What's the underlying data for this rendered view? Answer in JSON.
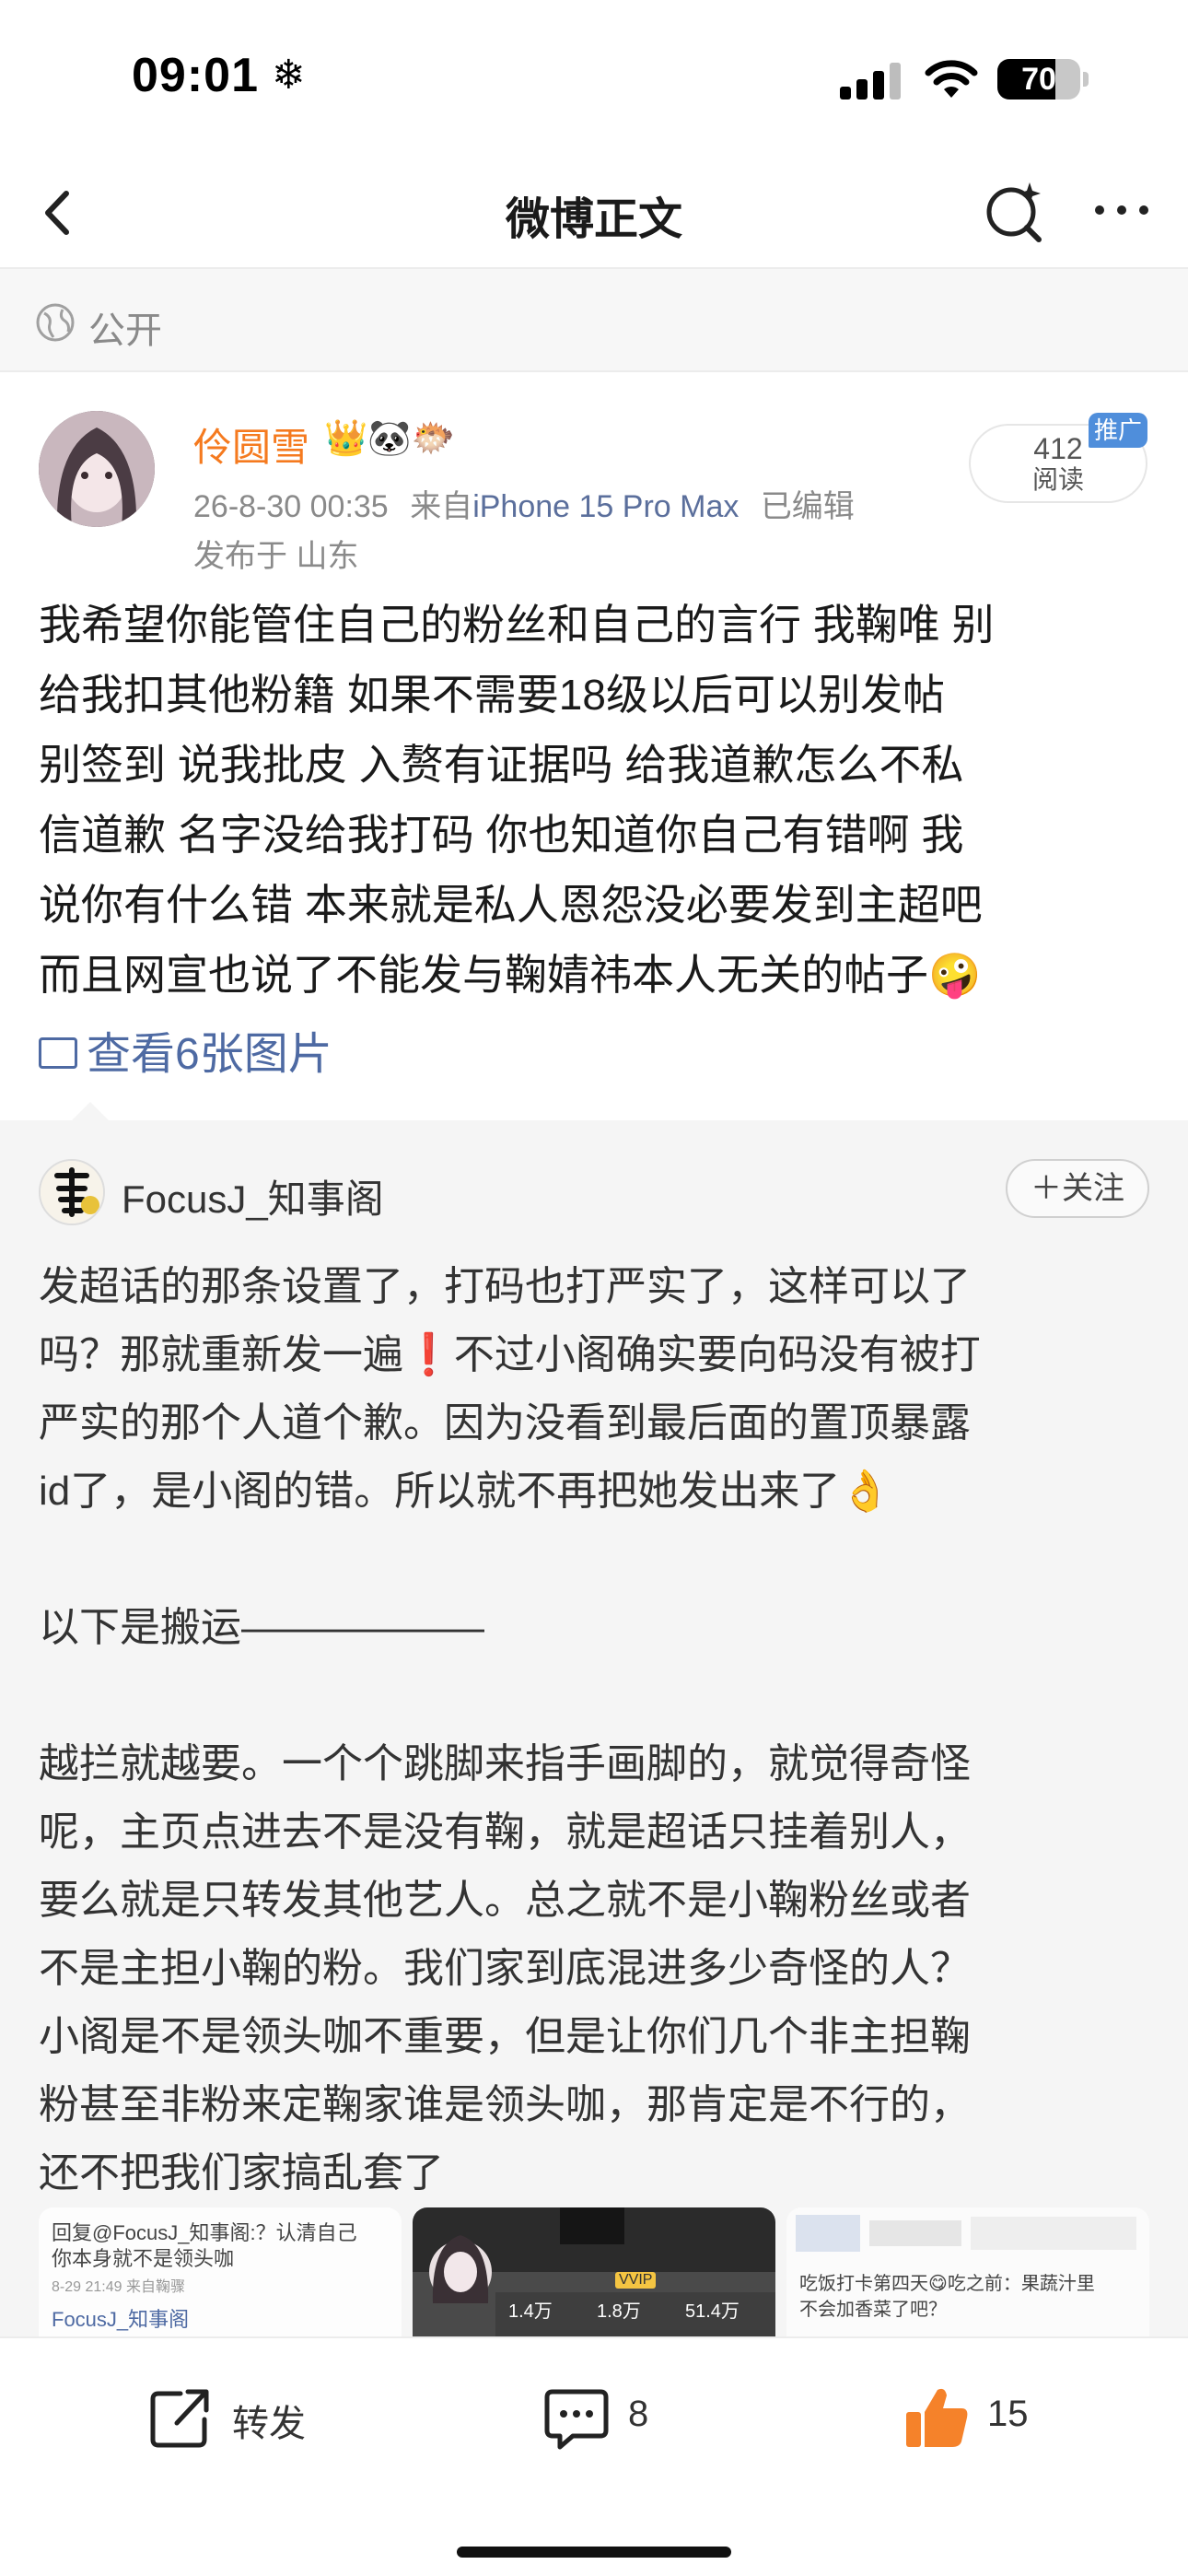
{
  "status_bar": {
    "time": "09:01",
    "snow": "❄",
    "battery": "70",
    "battery_level": 0.7
  },
  "nav": {
    "title": "微博正文",
    "back_icon": "chevron-left-icon",
    "search_icon": "search-sparkle-icon",
    "more_icon": "more-dots-icon"
  },
  "visibility": {
    "label": "公开"
  },
  "post": {
    "author": "伶圆雪",
    "badges": [
      "👑",
      "🐼",
      "🐡"
    ],
    "datetime": "26-8-30 00:35",
    "from_prefix": "来自",
    "device": "iPhone 15 Pro Max",
    "edited": "已编辑",
    "location": "发布于 山东",
    "reads": "412",
    "reads_label": "阅读",
    "promo": "推广",
    "body": "我希望你能管住自己的粉丝和自己的言行 我鞠唯 别\n给我扣其他粉籍 如果不需要18级以后可以别发帖\n别签到 说我批皮 入赘有证据吗 给我道歉怎么不私\n信道歉 名字没给我打码 你也知道你自己有错啊 我\n说你有什么错 本来就是私人恩怨没必要发到主超吧\n而且网宣也说了不能发与鞠婧祎本人无关的帖子🤪",
    "view_images": "查看6张图片"
  },
  "repost": {
    "author": "FocusJ_知事阁",
    "follow": "＋关注",
    "body": "发超话的那条设置了，打码也打严实了，这样可以了\n吗？那就重新发一遍❗️不过小阁确实要向码没有被打\n严实的那个人道个歉。因为没看到最后面的置顶暴露\nid了，是小阁的错。所以就不再把她发出来了👌\n\n以下是搬运——————\n\n越拦就越要。一个个跳脚来指手画脚的，就觉得奇怪\n呢，主页点进去不是没有鞠，就是超话只挂着别人，\n要么就是只转发其他艺人。总之就不是小鞠粉丝或者\n不是主担小鞠的粉。我们家到底混进多少奇怪的人？\n小阁是不是领头咖不重要，但是让你们几个非主担鞠\n粉甚至非粉来定鞠家谁是领头咖，那肯定是不行的，\n还不把我们家搞乱套了",
    "thumbs": [
      {
        "line1": "回复@FocusJ_知事阁:？认清自己",
        "line2": "你本身就不是领头咖",
        "meta": "8-29 21:49 来自鞠骤",
        "line3": "FocusJ_知事阁"
      },
      {
        "stat1": "1.4万",
        "stat2": "1.8万",
        "stat3": "51.4万",
        "tag": "VVIP"
      },
      {
        "line1": "吃饭打卡第四天😋吃之前：果蔬汁里",
        "line2": "不会加香菜了吧？"
      }
    ]
  },
  "actions": {
    "repost_label": "转发",
    "comment_count": "8",
    "like_count": "15"
  },
  "colors": {
    "author": "#f57a1f",
    "link": "#4e6aa3",
    "like": "#f5822a",
    "promo": "#4f8edb"
  }
}
